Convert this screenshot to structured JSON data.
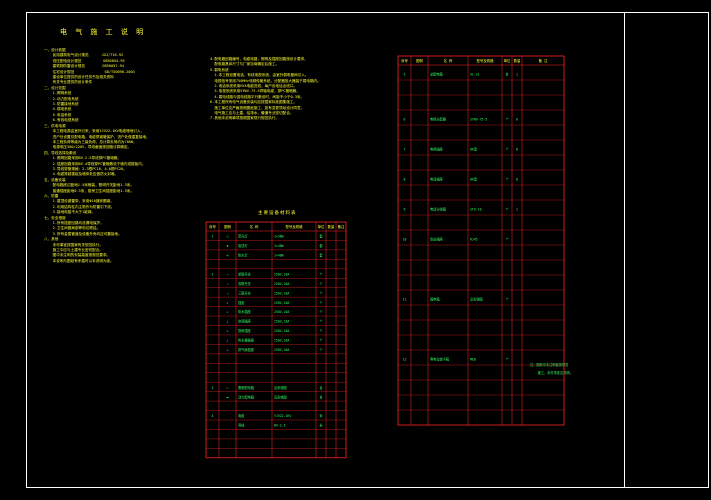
{
  "title": "电 气 施 工 说 明",
  "notes_col1": "一、设计依据\n    民用建筑电气设计规范      JGJ/T16-92\n    低压配电设计规范          GB50054-95\n    建筑物防雷设计规范        GB50057-94\n    住宅设计规范              GB/T50096-2003\n    建设单位提供的设计任务书及相关资料\n    有关专业提供的设计条件\n二、设计范围\n    1.照明系统\n    2.动力配电系统\n    3.防雷接地系统\n    4.弱电系统\n    5.电话系统\n    6.有线电视系统\n三、供电电源\n    本工程电源由室外引来，采用YJV22-1KV电缆埋地引入，\n    进户处设置总配电箱，电缆穿钢管保护，进户处做重复接地。\n    本工程负荷等级为三级负荷，总计算负荷约为70KW，\n    电源电压380/220V，导线截面按回路计算确定。\n四、导线选择及敷设\n    1.照明回路采用BV-2.5导线穿PC管暗敷。\n    2.插座回路采用BV-4导线穿PC管暗敷设于墙内或楼板内。\n    3.导线穿管规格：2-3根PC16，4-6根PC20。\n    4.电缆穿越楼板及墙体处应做防火封堵。\n五、设备安装\n    配电箱底边距地1.5米暗装，照明开关距地1.3米。\n    普通插座距地0.3米，厨房卫生间插座距地1.5米。\n六、防雷\n    1.屋顶设避雷带，采用Φ10镀锌圆钢。\n    2.利用结构柱内主筋作为防雷引下线。\n    3.接地电阻不大于1欧姆。\n七、安全措施\n    1.所有插座回路均设漏电保护。\n    2.卫生间做局部等电位联结。\n    3.所有金属管道及设备外壳均应可靠接地。\n八、其他\n    未尽事宜按国家有关规范执行。\n    施工中应与土建专业密切配合。\n    图中未注明的安装高度按规范要求。\n    本说明与图纸有矛盾时以本说明为准。",
  "notes_col2": "4.配电箱回路编号，电缆线路，照明及插座回路按设计要求，\n  配电箱具体尺寸与厂家协商确定后施工。\n5.弱电系统\n  1.本工程设置电话、有线电视系统，由室外弱电管网引入。\n  电视信号采用750MHz邻频传输系统，分配器放大器装于弱电箱内。\n  2.电话系统采用HYA电缆进线，每户设电话出线口。\n  3.电视系统采用SYWV-75-5同轴电缆，穿PC管暗敷。\n  4.弱电线路与强电线路平行敷设时，间距不小于0.3米。\n6.本工程所有电气设备安装均应按国家标准图集施工。\n  施工单位应严格按照图纸施工，如有变更须经设计同意。\n  电气施工应与土建、给排水、暖通专业密切配合。\n7.其他未说明事项按照国家现行规范执行。",
  "table_title": "主要设备材料表",
  "table_headers": [
    "序号",
    "图例",
    "名  称",
    "型号及规格",
    "单位",
    "数量",
    "备注"
  ],
  "left_rows": [
    [
      "1",
      "◯",
      "荧光灯",
      "1×36W",
      "套",
      "",
      ""
    ],
    [
      "",
      "▼",
      "吸顶灯",
      "1×40W",
      "套",
      "",
      ""
    ],
    [
      "",
      "⊗",
      "防水灯",
      "1×40W",
      "套",
      "",
      ""
    ],
    [
      "2",
      "↗",
      "单联开关",
      "250V,10A",
      "个",
      "",
      ""
    ],
    [
      "",
      "↗",
      "双联开关",
      "250V,10A",
      "个",
      "",
      ""
    ],
    [
      "",
      "↗",
      "三联开关",
      "250V,10A",
      "个",
      "",
      ""
    ],
    [
      "",
      "⊥",
      "插座",
      "250V,10A",
      "个",
      "",
      ""
    ],
    [
      "",
      "⊥",
      "防水插座",
      "250V,10A",
      "个",
      "",
      ""
    ],
    [
      "",
      "⊥",
      "空调插座",
      "250V,16A",
      "个",
      "",
      ""
    ],
    [
      "",
      "⊥",
      "厨房插座",
      "250V,10A",
      "个",
      "",
      ""
    ],
    [
      "",
      "⊥",
      "热水器插座",
      "250V,16A",
      "个",
      "",
      ""
    ],
    [
      "",
      "⊥",
      "排气扇插座",
      "250V,10A",
      "个",
      "",
      ""
    ],
    [
      "3",
      "▭",
      "照明配电箱",
      "见系统图",
      "台",
      "",
      ""
    ],
    [
      "",
      "▬",
      "动力配电箱",
      "见系统图",
      "台",
      "",
      ""
    ],
    [
      "4",
      "",
      "电缆",
      "YJV22-1KV",
      "米",
      "",
      ""
    ],
    [
      "",
      "",
      "导线",
      "BV-2.5",
      "米",
      "",
      ""
    ]
  ],
  "right_headers": [
    "序号",
    "图例",
    "名  称",
    "型号及规格",
    "单位",
    "数量",
    "备  注"
  ],
  "right_rows": [
    [
      "5",
      "",
      "总配电箱",
      "XL-21",
      "台",
      "1",
      ""
    ],
    [
      "6",
      "",
      "电视分配器",
      "SYWV-75-5",
      "个",
      "6",
      ""
    ],
    [
      "7",
      "",
      "电视插座",
      "86型",
      "个",
      "6",
      ""
    ],
    [
      "8",
      "",
      "电话插座",
      "86型",
      "个",
      "8",
      ""
    ],
    [
      "9",
      "",
      "电话分线箱",
      "STO-10",
      "个",
      "1",
      ""
    ],
    [
      "10",
      "",
      "信息插座",
      "RJ45",
      "个",
      "",
      ""
    ],
    [
      "11",
      "",
      "弱电箱",
      "见系统图",
      "个",
      "",
      ""
    ],
    [
      "12",
      "",
      "等电位端子箱",
      "MEB",
      "个",
      "",
      ""
    ]
  ],
  "right_note": "注：图例中未注明者按规范\n    施工，未尽事宜见说明。"
}
